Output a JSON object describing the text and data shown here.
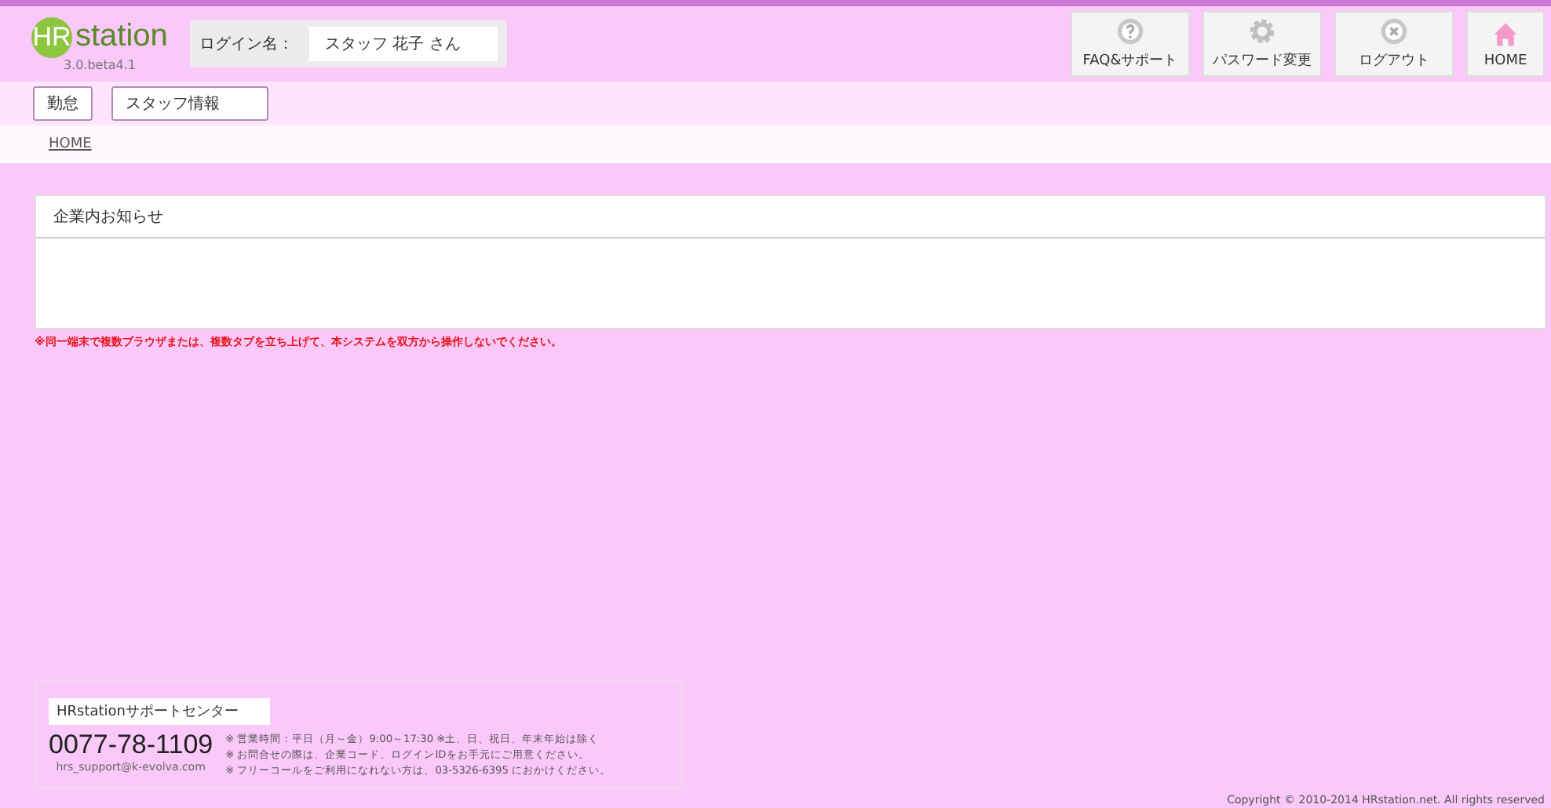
{
  "logo": {
    "badge": "HR",
    "word": "station",
    "version": "3.0.beta4.1"
  },
  "login": {
    "label": "ログイン名：",
    "value": "スタッフ 花子 さん"
  },
  "header_buttons": [
    {
      "kind": "help",
      "label": "FAQ&サポート"
    },
    {
      "kind": "gear",
      "label": "パスワード変更"
    },
    {
      "kind": "close",
      "label": "ログアウト"
    },
    {
      "kind": "home",
      "label": "HOME"
    }
  ],
  "menu": [
    "勤怠",
    "スタッフ情報"
  ],
  "breadcrumb": [
    "HOME"
  ],
  "notice": {
    "title": "企業内お知らせ"
  },
  "warning": "※同一端末で複数ブラウザまたは、複数タブを立ち上げて、本システムを双方から操作しないでください。",
  "support": {
    "title": "HRstationサポートセンター",
    "phone": "0077-78-1109",
    "email": "hrs_support@k-evolva.com",
    "notes": [
      "※ 営業時間：平日（月～金）9:00～17:30 ※土、日、祝日、年末年始は除く",
      "※ お問合せの際は、企業コード、ログインIDをお手元にご用意ください。",
      "※ フリーコールをご利用になれない方は、03-5326-6395 におかけください。"
    ]
  },
  "copyright": "Copyright © 2010-2014 HRstation.net. All rights reserved"
}
